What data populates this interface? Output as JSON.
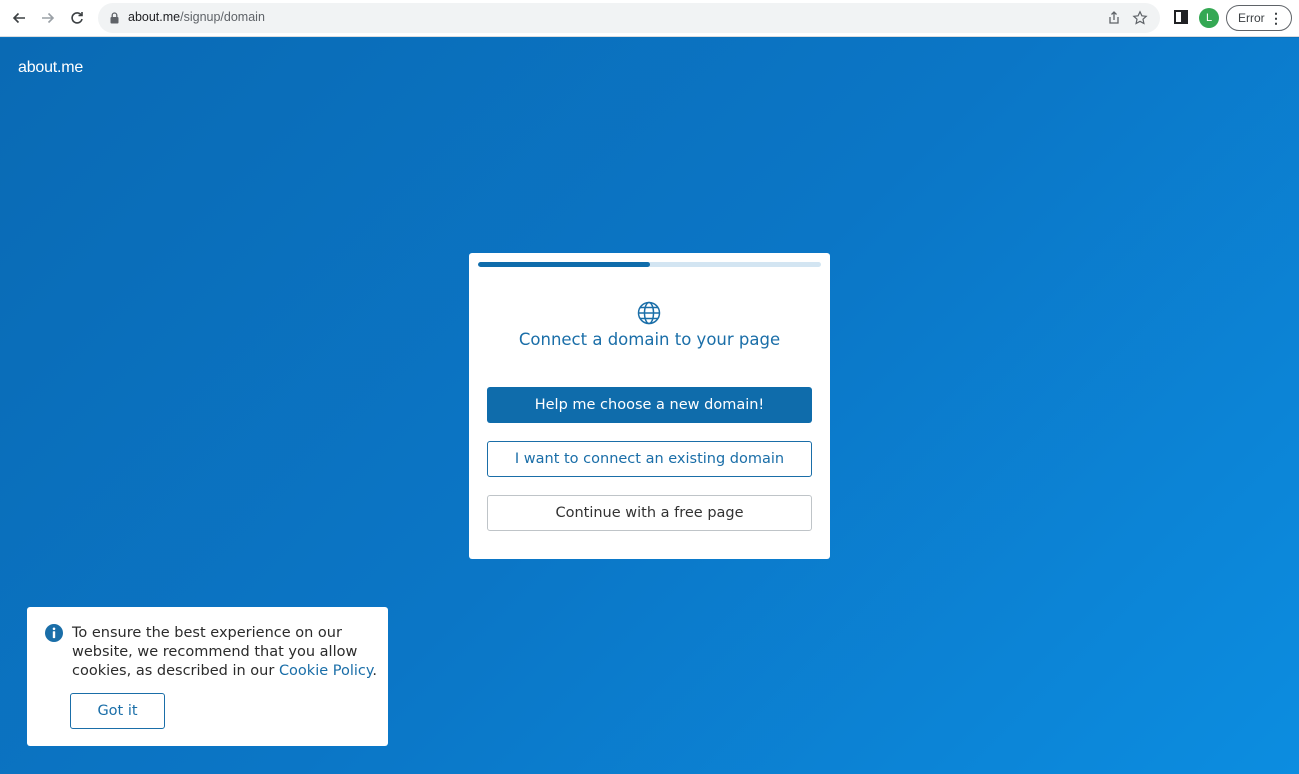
{
  "browser": {
    "url_host": "about.me",
    "url_path": "/signup/domain",
    "avatar_letter": "L",
    "error_label": "Error"
  },
  "page": {
    "logo": "about.me"
  },
  "modal": {
    "progress": 0.5,
    "title": "Connect a domain to your page",
    "buttons": {
      "choose_new": "Help me choose a new domain!",
      "connect_existing": "I want to connect an existing domain",
      "free_page": "Continue with a free page"
    }
  },
  "cookie_banner": {
    "text": "To ensure the best experience on our website, we recommend that you allow cookies, as described in our ",
    "link": "Cookie Policy",
    "suffix": ".",
    "button": "Got it"
  },
  "colors": {
    "brand_blue": "#0f6cab",
    "background_blue": "#0b76c6"
  },
  "icons": [
    "back-arrow-icon",
    "forward-arrow-icon",
    "reload-icon",
    "lock-icon",
    "share-icon",
    "star-icon",
    "side-panel-icon",
    "globe-icon",
    "info-icon"
  ]
}
